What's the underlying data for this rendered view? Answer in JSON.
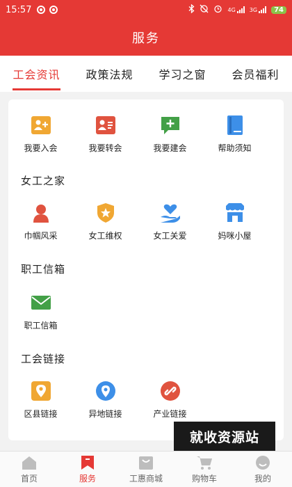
{
  "status_bar": {
    "time": "15:57",
    "net_4g": "4G",
    "net_3g": "3G",
    "battery": "74"
  },
  "header": {
    "title": "服务"
  },
  "tabs": [
    {
      "label": "工会资讯",
      "active": true
    },
    {
      "label": "政策法规",
      "active": false
    },
    {
      "label": "学习之窗",
      "active": false
    },
    {
      "label": "会员福利",
      "active": false
    }
  ],
  "services": {
    "row1": [
      {
        "label": "我要入会",
        "icon": "add-member-icon",
        "color": "#f0a733"
      },
      {
        "label": "我要转会",
        "icon": "transfer-card-icon",
        "color": "#e0533f"
      },
      {
        "label": "我要建会",
        "icon": "add-chat-icon",
        "color": "#43a047"
      },
      {
        "label": "帮助须知",
        "icon": "help-book-icon",
        "color": "#3d8fe8"
      }
    ],
    "women_section": {
      "title": "女工之家",
      "items": [
        {
          "label": "巾帼风采",
          "icon": "woman-avatar-icon",
          "color": "#e0533f"
        },
        {
          "label": "女工维权",
          "icon": "shield-star-icon",
          "color": "#f0a733"
        },
        {
          "label": "女工关爱",
          "icon": "caring-hand-icon",
          "color": "#3d8fe8"
        },
        {
          "label": "妈咪小屋",
          "icon": "store-icon",
          "color": "#3d8fe8"
        }
      ]
    },
    "mailbox_section": {
      "title": "职工信箱",
      "items": [
        {
          "label": "职工信箱",
          "icon": "mail-icon",
          "color": "#43a047"
        }
      ]
    },
    "links_section": {
      "title": "工会链接",
      "items": [
        {
          "label": "区县链接",
          "icon": "map-pin-icon",
          "color": "#f0a733"
        },
        {
          "label": "异地链接",
          "icon": "location-icon",
          "color": "#3d8fe8"
        },
        {
          "label": "产业链接",
          "icon": "chain-link-icon",
          "color": "#e0533f"
        }
      ]
    }
  },
  "watermark": "就收资源站",
  "bottom_nav": [
    {
      "label": "首页",
      "icon": "home-icon",
      "active": false
    },
    {
      "label": "服务",
      "icon": "service-bookmark-icon",
      "active": true
    },
    {
      "label": "工惠商城",
      "icon": "shop-icon",
      "active": false
    },
    {
      "label": "购物车",
      "icon": "cart-icon",
      "active": false
    },
    {
      "label": "我的",
      "icon": "profile-icon",
      "active": false
    }
  ],
  "colors": {
    "brand_red": "#e53935"
  }
}
